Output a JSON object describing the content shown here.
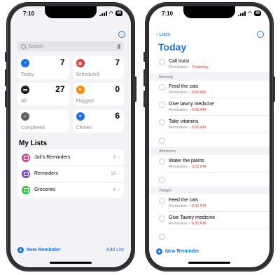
{
  "left": {
    "status": {
      "time": "7:10",
      "battery": "49"
    },
    "search": {
      "placeholder": "Search"
    },
    "smart_lists": [
      {
        "label": "Today",
        "count": "7",
        "color": "#1a73e8",
        "icon": "calendar-icon"
      },
      {
        "label": "Scheduled",
        "count": "7",
        "color": "#e53935",
        "icon": "calendar-grid-icon"
      },
      {
        "label": "All",
        "count": "27",
        "color": "#1c1c1e",
        "icon": "tray-icon"
      },
      {
        "label": "Flagged",
        "count": "0",
        "color": "#fb8c00",
        "icon": "flag-icon"
      },
      {
        "label": "Completed",
        "count": "",
        "color": "#5f6368",
        "icon": "checkmark-icon"
      },
      {
        "label": "Chores",
        "count": "6",
        "color": "#1a73e8",
        "icon": "person-icon"
      }
    ],
    "my_lists_title": "My Lists",
    "lists": [
      {
        "name": "Juli's Reminders",
        "count": "0",
        "color": "#e040a0"
      },
      {
        "name": "Reminders",
        "count": "13",
        "color": "#8e44d0"
      },
      {
        "name": "Groceries",
        "count": "8",
        "color": "#2ecc40"
      }
    ],
    "new_reminder": "New Reminder",
    "add_list": "Add List"
  },
  "right": {
    "status": {
      "time": "7:10",
      "battery": "49"
    },
    "back_label": "Lists",
    "title": "Today",
    "tasks_top": [
      {
        "title": "Call truist",
        "list": "Reminders",
        "due": "Yesterday"
      }
    ],
    "sections": [
      {
        "header": "Morning",
        "tasks": [
          {
            "title": "Feed the cats",
            "list": "Reminders",
            "due": "9:00 AM"
          },
          {
            "title": "Give tawny medicine",
            "list": "Reminders",
            "due": "9:00 AM"
          },
          {
            "title": "Take vitamins",
            "list": "Reminders",
            "due": "9:00 AM"
          }
        ]
      },
      {
        "header": "Afternoon",
        "tasks": [
          {
            "title": "Water the plants",
            "list": "Reminders",
            "due": "3:00 PM"
          }
        ]
      },
      {
        "header": "Tonight",
        "tasks": [
          {
            "title": "Feed the cats",
            "list": "Reminders",
            "due": "6:00 PM"
          },
          {
            "title": "Give Tawny medicine",
            "list": "Reminders",
            "due": "6:00 PM"
          }
        ]
      }
    ],
    "dash_sep": " – ",
    "new_reminder": "New Reminder"
  }
}
